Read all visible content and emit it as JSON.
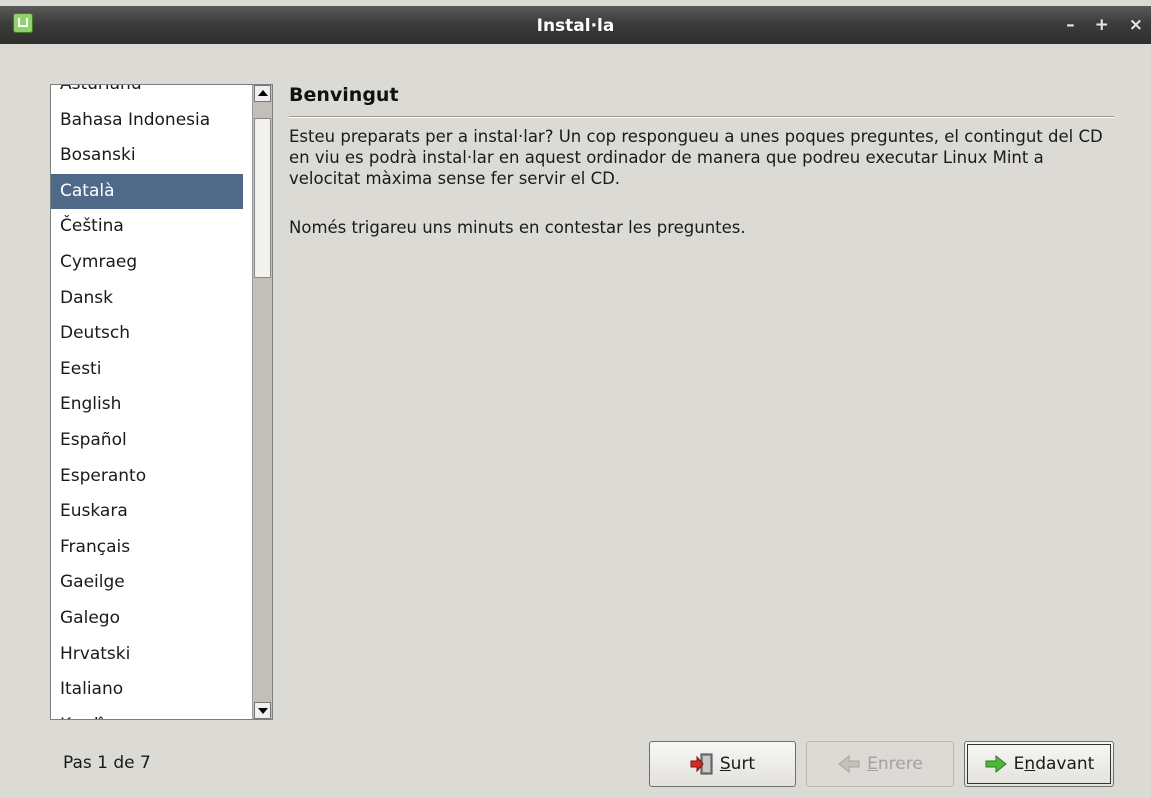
{
  "window": {
    "title": "Instal·la",
    "controls": [
      "–",
      "+",
      "×"
    ]
  },
  "languages": {
    "partial_top": "Asturianu",
    "items": [
      "Bahasa Indonesia",
      "Bosanski",
      "Català",
      "Čeština",
      "Cymraeg",
      "Dansk",
      "Deutsch",
      "Eesti",
      "English",
      "Español",
      "Esperanto",
      "Euskara",
      "Français",
      "Gaeilge",
      "Galego",
      "Hrvatski",
      "Italiano"
    ],
    "partial_bottom": "Kurdî",
    "selected": "Català"
  },
  "main": {
    "heading": "Benvingut",
    "paragraph1": "Esteu preparats per a instal·lar? Un cop respongueu a unes poques preguntes, el contingut del CD en viu es podrà instal·lar en aquest ordinador de manera que podreu executar Linux Mint a velocitat màxima sense fer servir el CD.",
    "paragraph2": "Només trigareu uns minuts en contestar les preguntes."
  },
  "footer": {
    "step": "Pas 1 de 7",
    "quit_label": "Surt",
    "back_label": "Enrere",
    "next_label": "Endavant"
  },
  "icons": {
    "app": "linux-mint-icon",
    "quit": "exit-door-icon",
    "back": "arrow-left-icon",
    "next": "arrow-right-icon"
  },
  "colors": {
    "titlebar": "#3c3c3c",
    "selection": "#4f6a88",
    "background": "#dcdad5",
    "next_arrow": "#4fb83b",
    "quit_arrow": "#d42a2a"
  }
}
